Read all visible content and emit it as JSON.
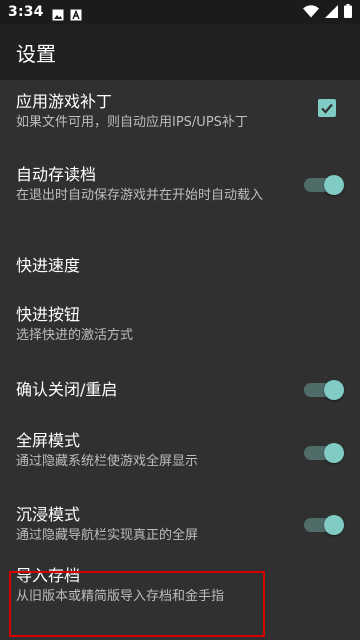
{
  "status_bar": {
    "time": "3:34",
    "icons_left": [
      "image-icon",
      "a-badge-icon"
    ],
    "icons_right": [
      "wifi-icon",
      "signal-icon",
      "battery-icon"
    ]
  },
  "app_bar": {
    "title": "设置"
  },
  "colors": {
    "accent": "#80cbc4",
    "background": "#303030",
    "highlight": "#d50000"
  },
  "settings": [
    {
      "title": "应用游戏补丁",
      "summary": "如果文件可用，则自动应用IPS/UPS补丁",
      "control": "checkbox",
      "checked": true
    },
    {
      "title": "自动存读档",
      "summary": "在退出时自动保存游戏并在开始时自动载入",
      "control": "switch",
      "checked": true
    },
    {
      "title": "快进速度",
      "summary": "",
      "control": "none"
    },
    {
      "title": "快进按钮",
      "summary": "选择快进的激活方式",
      "control": "none"
    },
    {
      "title": "确认关闭/重启",
      "summary": "",
      "control": "switch",
      "checked": true
    },
    {
      "title": "全屏模式",
      "summary": "通过隐藏系统栏使游戏全屏显示",
      "control": "switch",
      "checked": true
    },
    {
      "title": "沉浸模式",
      "summary": "通过隐藏导航栏实现真正的全屏",
      "control": "switch",
      "checked": true
    },
    {
      "title": "导入存档",
      "summary": "从旧版本或精简版导入存档和金手指",
      "control": "none",
      "highlighted": true
    }
  ]
}
